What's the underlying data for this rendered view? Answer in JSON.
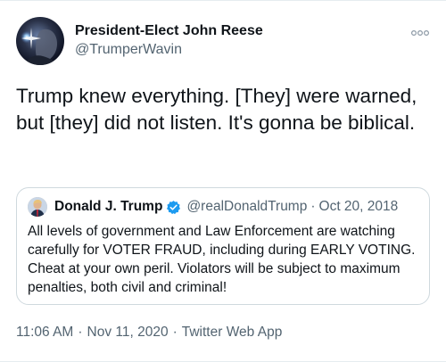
{
  "author": {
    "display_name": "President-Elect John Reese",
    "handle": "@TrumperWavin",
    "avatar_icon": "profile-photo-avatar"
  },
  "tweet": {
    "text": "Trump knew everything. [They] were warned, but [they] did not listen. It's gonna be biblical."
  },
  "quoted_tweet": {
    "display_name": "Donald J. Trump",
    "handle": "@realDonaldTrump",
    "separator": "·",
    "date": "Oct 20, 2018",
    "verified_icon": "verified-badge-icon",
    "text": "All levels of government and Law Enforcement are watching carefully for VOTER FRAUD, including during EARLY VOTING. Cheat at your own peril. Violators will be subject to maximum penalties, both civil and criminal!"
  },
  "meta": {
    "time": "11:06 AM",
    "separator": "·",
    "date": "Nov 11, 2020",
    "source": "Twitter Web App"
  },
  "colors": {
    "text_primary": "#0f1419",
    "text_secondary": "#536471",
    "verified_blue": "#1d9bf0",
    "border": "#cfd9de"
  }
}
